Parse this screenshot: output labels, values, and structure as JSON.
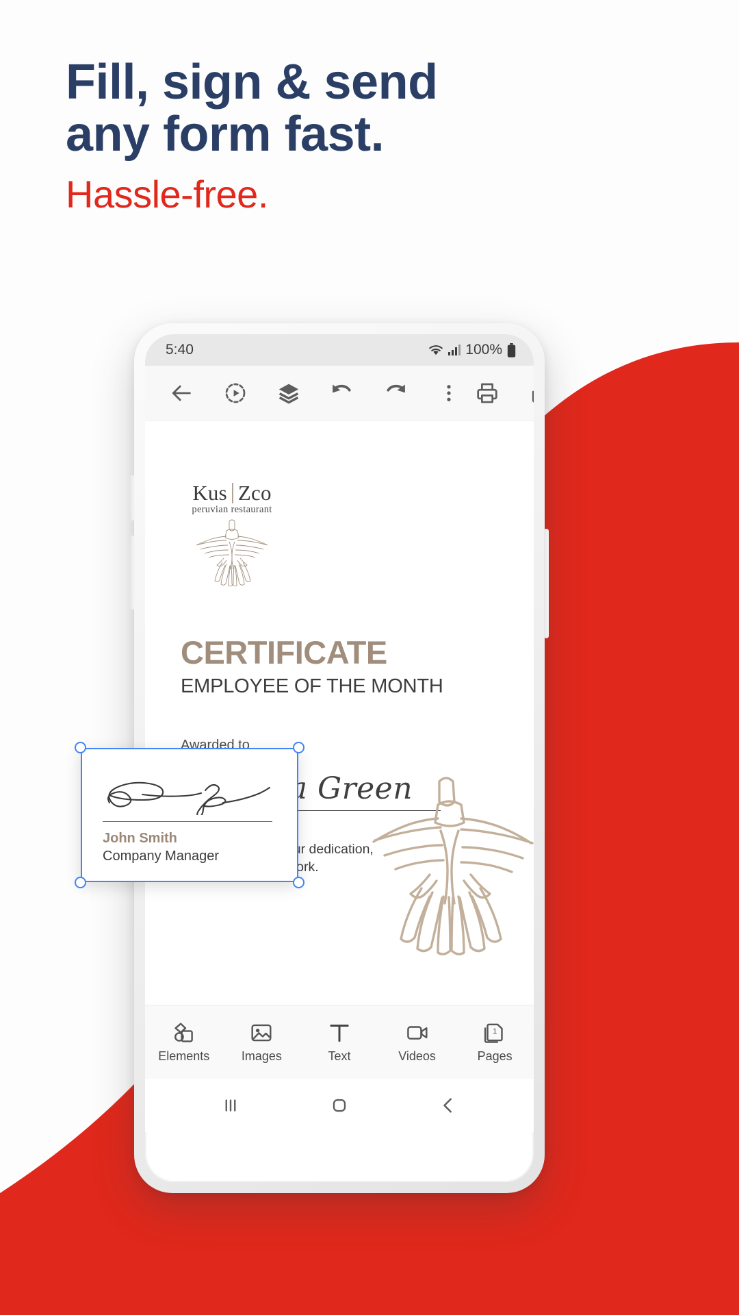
{
  "promo": {
    "headline_line1": "Fill, sign & send",
    "headline_line2": "any form fast.",
    "subheadline": "Hassle-free.",
    "headline_color": "#2b3f66",
    "subheadline_color": "#e0281c",
    "background_accent_color": "#e0281c"
  },
  "phone": {
    "status_bar": {
      "time": "5:40",
      "battery_percent": "100%",
      "icons": [
        "wifi-icon",
        "cellular-signal-icon",
        "battery-icon"
      ]
    },
    "app_toolbar": {
      "buttons": [
        {
          "name": "back-button",
          "icon": "arrow-left-icon"
        },
        {
          "name": "present-button",
          "icon": "play-circle-dashed-icon"
        },
        {
          "name": "layers-button",
          "icon": "layers-icon"
        },
        {
          "name": "undo-button",
          "icon": "undo-icon"
        },
        {
          "name": "redo-button",
          "icon": "redo-icon"
        },
        {
          "name": "more-options-button",
          "icon": "kebab-menu-icon"
        },
        {
          "name": "print-button",
          "icon": "printer-icon"
        },
        {
          "name": "share-button",
          "icon": "share-upload-icon"
        }
      ]
    },
    "certificate": {
      "logo_word_left": "Kus",
      "logo_word_right": "Zco",
      "logo_tagline": "peruvian restaurant",
      "logo_mark": "condor-bird-icon",
      "title": "CERTIFICATE",
      "title_color": "#a08d7c",
      "subtitle": "EMPLOYEE OF THE MONTH",
      "awarded_label": "Awarded to",
      "recipient_name": "Amanda Green",
      "recognition_text": "In recognition of your dedication, passion and hard work."
    },
    "signature_block": {
      "selected": true,
      "selection_color": "#4285f4",
      "signature_mark": "handwritten-signature-icon",
      "signer_name": "John Smith",
      "signer_name_color": "#9b8877",
      "signer_role": "Company Manager"
    },
    "bottom_nav": {
      "items": [
        {
          "label": "Elements",
          "icon": "elements-shapes-icon"
        },
        {
          "label": "Images",
          "icon": "image-icon"
        },
        {
          "label": "Text",
          "icon": "text-t-icon"
        },
        {
          "label": "Videos",
          "icon": "video-camera-icon"
        },
        {
          "label": "Pages",
          "icon": "pages-icon",
          "badge": "1"
        }
      ]
    },
    "system_nav": {
      "recents_label": "recents-icon",
      "home_label": "home-icon",
      "back_label": "back-chevron-icon"
    }
  }
}
